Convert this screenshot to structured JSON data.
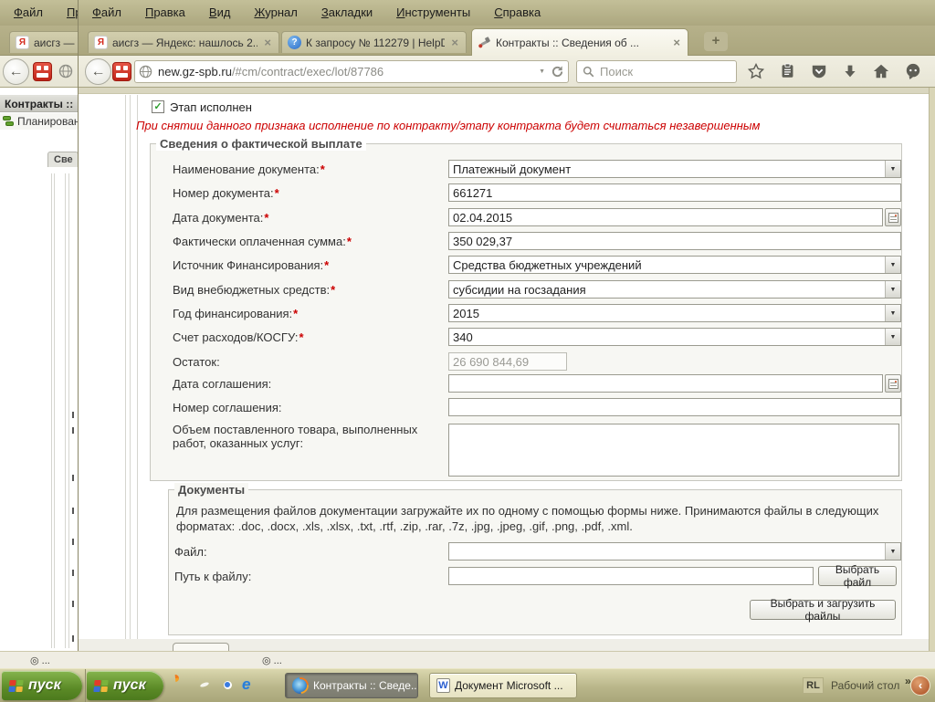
{
  "icons": {
    "close": "×",
    "plus": "+",
    "caret": "▼",
    "back": "←",
    "check": "✓",
    "chevrons": "»",
    "collapse": "‹",
    "ie_letter": "e",
    "word_letter": "W",
    "yandex_letter": "Я",
    "help_mark": "?"
  },
  "back_window": {
    "menu": {
      "file": "Файл",
      "edit": "Правка"
    },
    "tab_title": "аисгз —",
    "page_header": "Контракты ::",
    "nav_item": "Планирован",
    "panel_tab": "Све",
    "status": "◎ ..."
  },
  "browser": {
    "menu": {
      "file": "Файл",
      "edit": "Правка",
      "view": "Вид",
      "history": "Журнал",
      "bookmarks": "Закладки",
      "tools": "Инструменты",
      "help": "Справка"
    },
    "tabs": [
      {
        "title": "аисгз — Яндекс: нашлось 2..."
      },
      {
        "title": "К запросу № 112279 | HelpD..."
      },
      {
        "title": "Контракты :: Сведения об ..."
      }
    ],
    "url": {
      "domain": "new.gz-spb.ru",
      "path": "/#cm/contract/exec/lot/87786"
    },
    "search_placeholder": "Поиск"
  },
  "page": {
    "stage_done_label": "Этап исполнен",
    "warning": "При снятии данного признака исполнение по контракту/этапу контракта будет считаться незавершенным",
    "payment_legend": "Сведения о фактической выплате",
    "fields": [
      {
        "label": "Наименование документа:",
        "star": "*",
        "value": "Платежный документ"
      },
      {
        "label": "Номер документа:",
        "star": "*",
        "value": "661271"
      },
      {
        "label": "Дата документа:",
        "star": "*",
        "value": "02.04.2015"
      },
      {
        "label": "Фактически оплаченная сумма:",
        "star": "*",
        "value": "350 029,37"
      },
      {
        "label": "Источник Финансирования:",
        "star": "*",
        "value": "Средства бюджетных учреждений"
      },
      {
        "label": "Вид внебюджетных средств:",
        "star": "*",
        "value": "субсидии на госзадания"
      },
      {
        "label": "Год финансирования:",
        "star": "*",
        "value": "2015"
      },
      {
        "label": "Счет расходов/КОСГУ:",
        "star": "*",
        "value": "340"
      },
      {
        "label": "Остаток:",
        "star": "",
        "value": "26 690 844,69"
      },
      {
        "label": "Дата соглашения:",
        "star": "",
        "value": ""
      },
      {
        "label": "Номер соглашения:",
        "star": "",
        "value": ""
      },
      {
        "label": "Объем поставленного товара, выполненных работ, оказанных услуг:",
        "star": "",
        "value": ""
      }
    ],
    "documents": {
      "legend": "Документы",
      "hint": "Для размещения файлов документации загружайте их по одному с помощью формы ниже. Принимаются файлы в следующих форматах: .doc, .docx, .xls, .xlsx, .txt, .rtf, .zip, .rar, .7z, .jpg, .jpeg, .gif, .png, .pdf, .xml.",
      "file_label": "Файл:",
      "path_label": "Путь к файлу:",
      "choose_file": "Выбрать файл",
      "upload": "Выбрать и загрузить файлы"
    },
    "status_left": "◎ ...",
    "status_right": "◎ ..."
  },
  "taskbar": {
    "start": "пуск",
    "start2": "пуск",
    "window_buttons": [
      {
        "title": "Контракты :: Сведе..."
      },
      {
        "title": "Документ Microsoft ..."
      }
    ],
    "lang": "RL",
    "desktop": "Рабочий стол"
  }
}
